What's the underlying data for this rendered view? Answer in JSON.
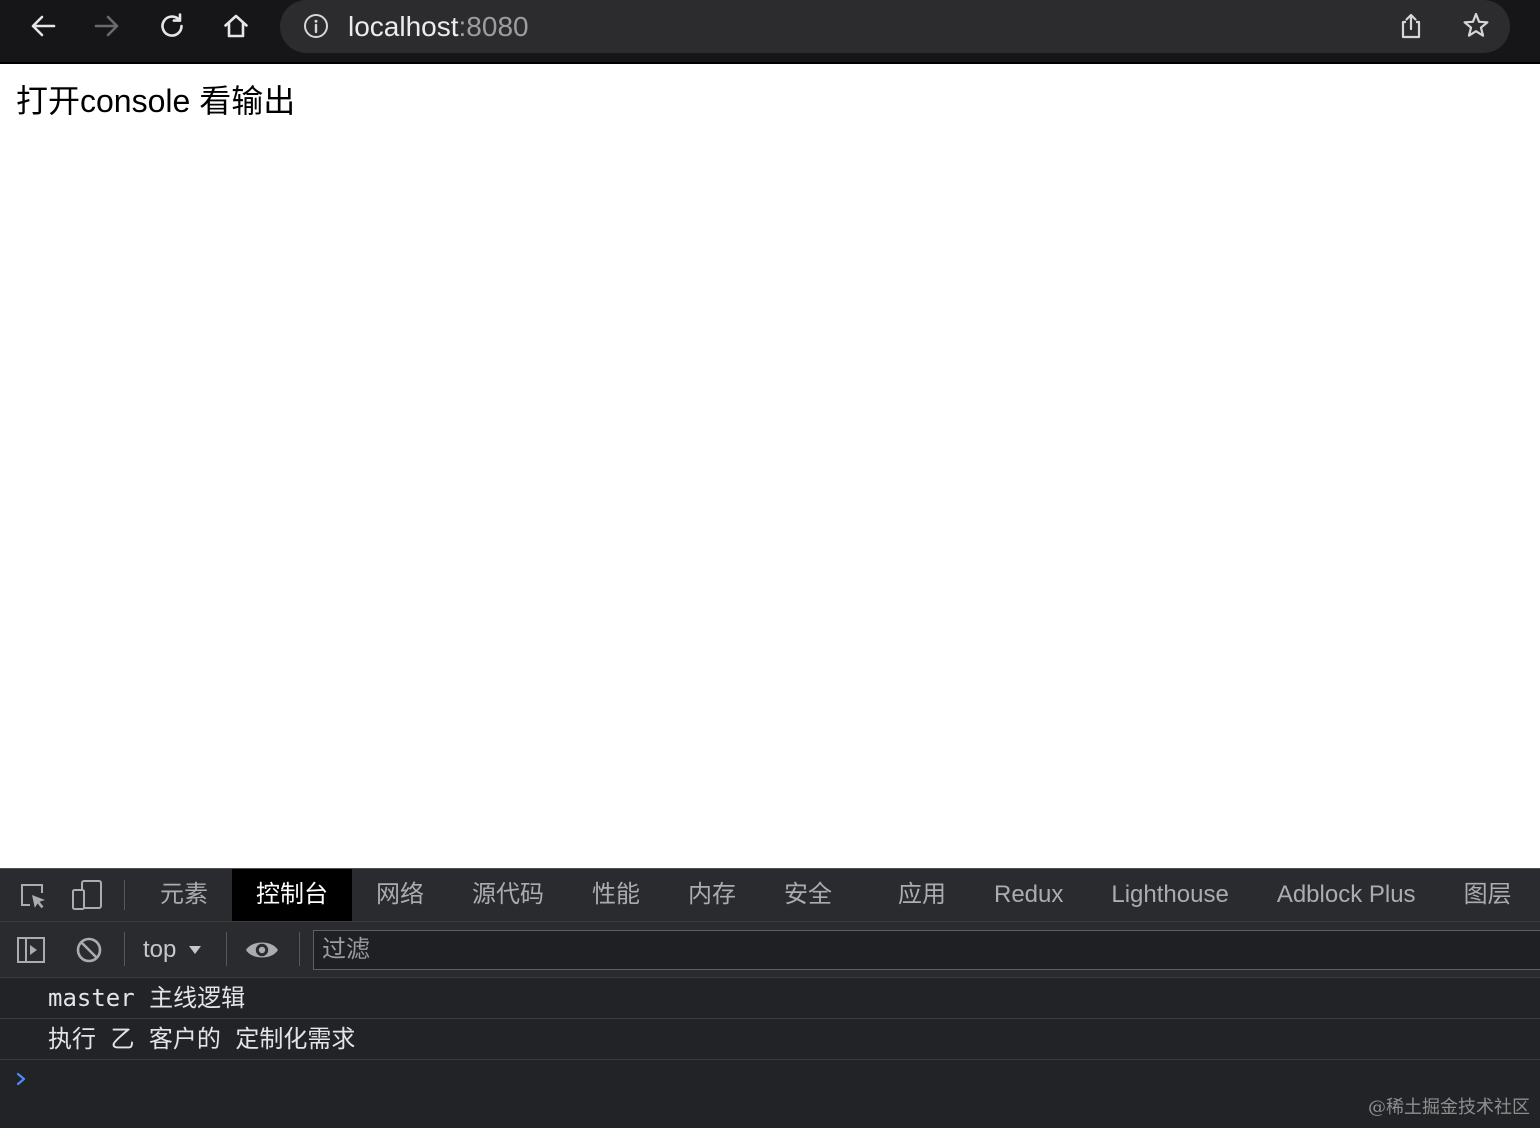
{
  "window": {
    "nav": {
      "back_icon": "back-arrow-icon",
      "forward_icon": "forward-arrow-icon",
      "reload_icon": "reload-icon",
      "home_icon": "home-icon"
    },
    "address_bar": {
      "site_info_icon": "info-icon",
      "host": "localhost",
      "port": ":8080",
      "share_icon": "share-icon",
      "bookmark_icon": "star-icon"
    }
  },
  "page": {
    "text": "打开console 看输出"
  },
  "devtools": {
    "toolbar_icons": {
      "inspect": "inspect-element-icon",
      "device": "device-toolbar-icon"
    },
    "tabs": [
      {
        "label": "元素",
        "selected": false
      },
      {
        "label": "控制台",
        "selected": true
      },
      {
        "label": "网络",
        "selected": false
      },
      {
        "label": "源代码",
        "selected": false
      },
      {
        "label": "性能",
        "selected": false
      },
      {
        "label": "内存",
        "selected": false
      },
      {
        "label": "安全",
        "selected": false
      },
      {
        "label": "应用",
        "selected": false
      },
      {
        "label": "Redux",
        "selected": false
      },
      {
        "label": "Lighthouse",
        "selected": false
      },
      {
        "label": "Adblock Plus",
        "selected": false
      },
      {
        "label": "图层",
        "selected": false
      }
    ],
    "console_toolbar": {
      "sidebar_icon": "sidebar-toggle-icon",
      "clear_icon": "clear-console-icon",
      "context": "top",
      "context_icon": "dropdown-arrow-icon",
      "live_expression_icon": "eye-icon",
      "filter_placeholder": "过滤"
    },
    "messages": [
      {
        "text": "master 主线逻辑"
      },
      {
        "text": "执行 乙 客户的 定制化需求"
      }
    ],
    "prompt_icon": "prompt-chevron-icon"
  },
  "watermark": "@稀土掘金技术社区",
  "colors": {
    "toolbar_bg": "#161618",
    "omnibox_bg": "#2c2c2f",
    "url_host": "#ececec",
    "url_port": "#9d9d9d",
    "devtools_bar_bg": "#2a2b2e",
    "devtools_bg": "#222326",
    "selected_tab_bg": "#000000",
    "tab_text": "#a9acb0",
    "selected_tab_text": "#ffffff",
    "console_text": "#e3e4e6",
    "prompt": "#4c8bf5"
  }
}
